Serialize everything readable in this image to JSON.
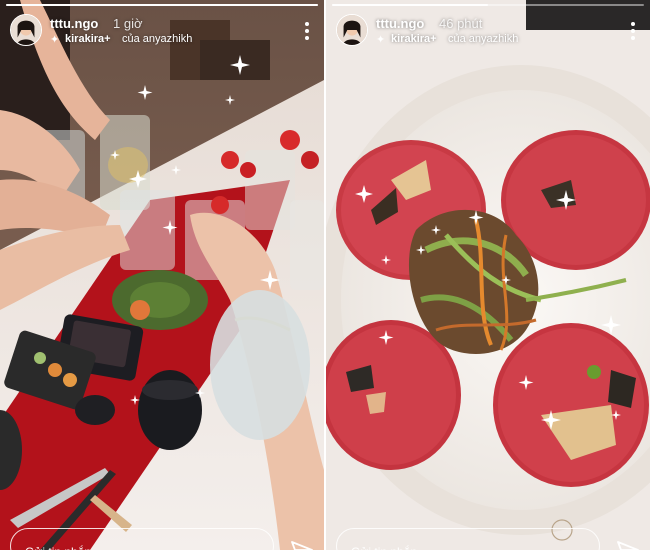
{
  "stories": [
    {
      "username": "tttu.ngo",
      "time_ago": "1 giờ",
      "effect_name": "kirakira+",
      "effect_credit": "của anyazhikh",
      "reply_placeholder": "Gửi tin nhắn",
      "progress": 1.0
    },
    {
      "username": "tttu.ngo",
      "time_ago": "46 phút",
      "effect_name": "kirakira+",
      "effect_credit": "của anyazhikh",
      "reply_placeholder": "Gửi tin nhắn",
      "progress": 0.5
    }
  ],
  "icons": {
    "effect": "sparkle-icon",
    "more": "more-options-icon",
    "send": "send-paper-plane-icon"
  },
  "colors": {
    "text": "#ffffff",
    "table_runner": "#b3121b",
    "plate": "#f3efea",
    "beef": "#c83a44"
  }
}
